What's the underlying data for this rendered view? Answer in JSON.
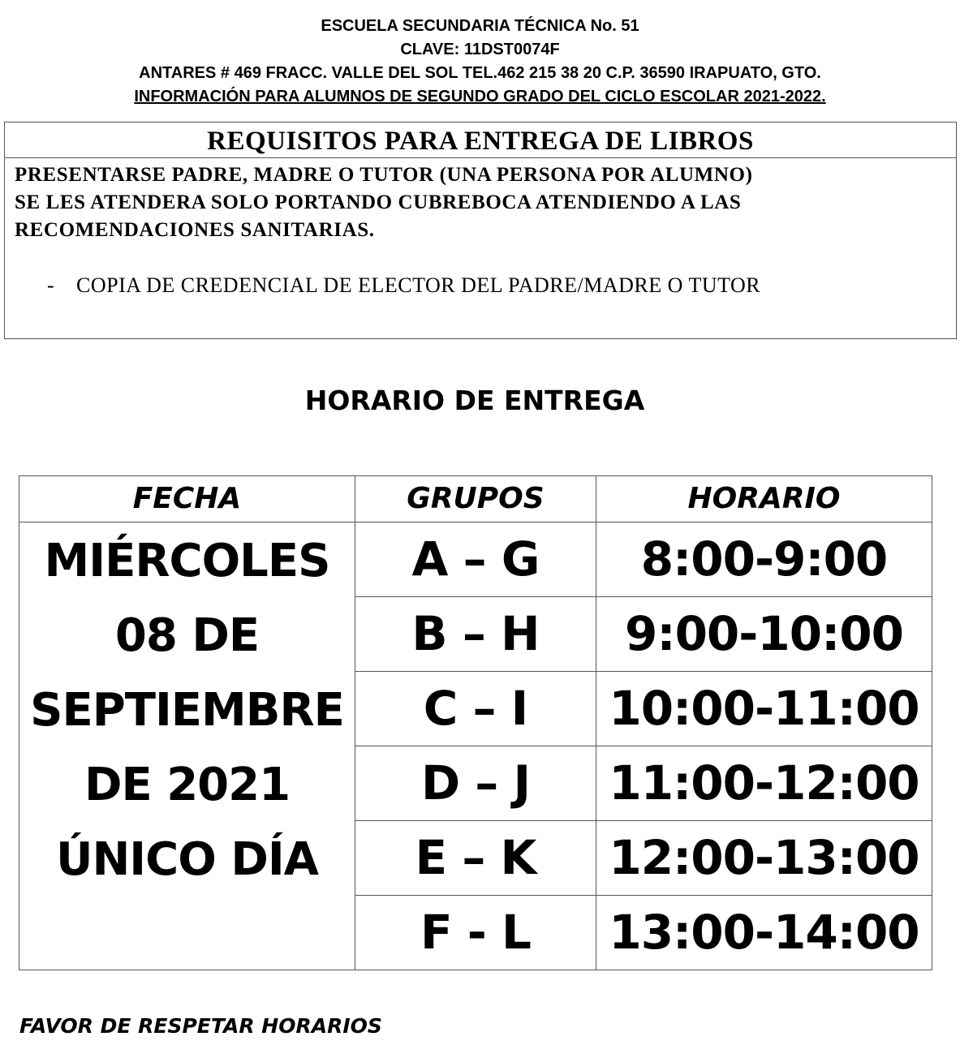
{
  "header": {
    "school": "ESCUELA SECUNDARIA TÉCNICA No. 51",
    "clave": "CLAVE: 11DST0074F",
    "address": "ANTARES # 469 FRACC. VALLE DEL SOL TEL.462 215 38 20 C.P. 36590 IRAPUATO, GTO.",
    "info": "INFORMACIÓN PARA ALUMNOS DE SEGUNDO GRADO  DEL CICLO ESCOLAR 2021-2022."
  },
  "requirements": {
    "title": "REQUISITOS PARA ENTREGA DE LIBROS",
    "lines": [
      "PRESENTARSE PADRE, MADRE O TUTOR (UNA PERSONA POR ALUMNO)",
      "SE LES ATENDERA SOLO PORTANDO CUBREBOCA ATENDIENDO A LAS",
      "RECOMENDACIONES SANITARIAS."
    ],
    "items": [
      {
        "bullet": "-",
        "text": "COPIA DE CREDENCIAL DE ELECTOR DEL PADRE/MADRE O TUTOR"
      }
    ]
  },
  "schedule": {
    "title": "HORARIO DE ENTREGA",
    "headers": {
      "date": "FECHA",
      "groups": "GRUPOS",
      "time": "HORARIO"
    },
    "date_lines": [
      "MIÉRCOLES",
      "08 DE",
      "SEPTIEMBRE",
      "DE 2021",
      "ÚNICO DÍA"
    ],
    "rows": [
      {
        "groups": "A – G",
        "time": "8:00-9:00"
      },
      {
        "groups": "B – H",
        "time": "9:00-10:00"
      },
      {
        "groups": "C – I",
        "time": "10:00-11:00"
      },
      {
        "groups": "D – J",
        "time": "11:00-12:00"
      },
      {
        "groups": "E – K",
        "time": "12:00-13:00"
      },
      {
        "groups": "F - L",
        "time": "13:00-14:00"
      }
    ]
  },
  "footer": {
    "note": "FAVOR DE RESPETAR HORARIOS"
  }
}
